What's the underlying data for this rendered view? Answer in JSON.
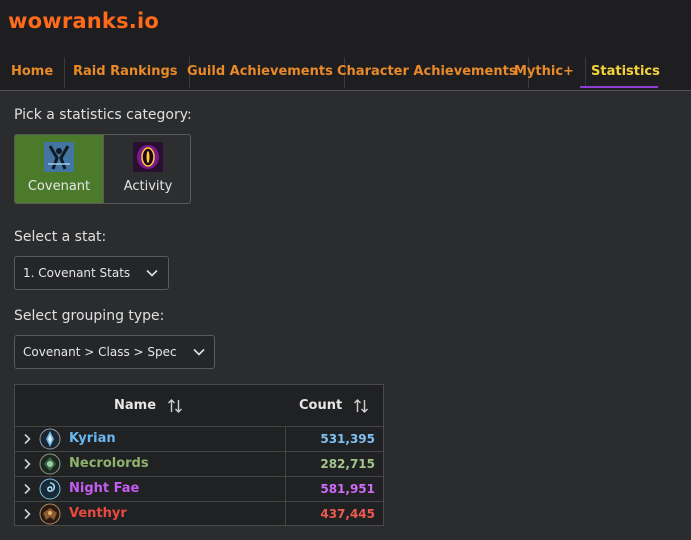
{
  "site": {
    "logo": "wowranks.io",
    "logo_color": "#ff6b1a"
  },
  "nav": {
    "items": [
      {
        "label": "Home"
      },
      {
        "label": "Raid Rankings"
      },
      {
        "label": "Guild Achievements"
      },
      {
        "label": "Character Achievements"
      },
      {
        "label": "Mythic+"
      },
      {
        "label": "Statistics",
        "active": true
      }
    ]
  },
  "category": {
    "prompt": "Pick a statistics category:",
    "options": [
      {
        "label": "Covenant",
        "icon": "covenant-icon",
        "active": true
      },
      {
        "label": "Activity",
        "icon": "activity-icon",
        "active": false
      }
    ]
  },
  "stat": {
    "prompt": "Select a stat:",
    "value": "1. Covenant Stats"
  },
  "grouping": {
    "prompt": "Select grouping type:",
    "value": "Covenant > Class > Spec"
  },
  "table": {
    "columns": {
      "name": "Name",
      "count": "Count"
    },
    "rows": [
      {
        "name": "Kyrian",
        "count": "531,395",
        "color": "#68b8f0",
        "count_color": "#7fc0f2",
        "icon": "kyrian-icon"
      },
      {
        "name": "Necrolords",
        "count": "282,715",
        "color": "#8fb36b",
        "count_color": "#a3c48b",
        "icon": "necrolords-icon"
      },
      {
        "name": "Night Fae",
        "count": "581,951",
        "color": "#c45cf0",
        "count_color": "#cf6cf5",
        "icon": "night-fae-icon"
      },
      {
        "name": "Venthyr",
        "count": "437,445",
        "color": "#e84a40",
        "count_color": "#ee5a50",
        "icon": "venthyr-icon"
      }
    ]
  }
}
